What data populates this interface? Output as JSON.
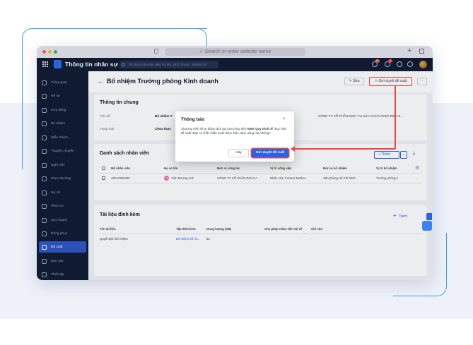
{
  "browser": {
    "url_placeholder": "Search or enter website name"
  },
  "app": {
    "title": "Thông tin nhân sự",
    "search_placeholder": "Tìm theo mã nhân viên, họ tên, SĐT, Email... (Nhấn F4)",
    "badges": [
      "99+",
      "9"
    ]
  },
  "sidebar": {
    "items": [
      {
        "label": "Tổng quan"
      },
      {
        "label": "Hồ sơ"
      },
      {
        "label": "Hợp đồng"
      },
      {
        "label": "Bổ nhiệm"
      },
      {
        "label": "Miễn nhiệm"
      },
      {
        "label": "Thuyên chuyển"
      },
      {
        "label": "Nghỉ việc"
      },
      {
        "label": "Khen thưởng"
      },
      {
        "label": "Sự cố"
      },
      {
        "label": "Phúc lợi"
      },
      {
        "label": "Quy hoạch"
      },
      {
        "label": "Đồng phục"
      },
      {
        "label": "Đề xuất"
      },
      {
        "label": "Báo cáo"
      },
      {
        "label": "Thiết lập"
      }
    ]
  },
  "page": {
    "title": "Bổ nhiệm Trưởng phòng Kinh doanh",
    "edit_label": "Sửa",
    "submit_label": "Gửi duyệt đề xuất",
    "more_label": "···"
  },
  "general": {
    "title": "Thông tin chung",
    "subject_label": "Tiêu đề",
    "subject_value": "Bổ nhiệm T",
    "status_label": "Trạng thái",
    "status_value": "Chưa thực",
    "company_value": "CÔNG TY CỔ PHẦN DỊCH VỤ SỬA CHỮA NHẸT ĐIỆN 8..."
  },
  "employees": {
    "title": "Danh sách nhân viên",
    "add_label": "Thêm",
    "columns": [
      "Mã nhân viên",
      "Họ và tên",
      "Đơn vị công tác",
      "Vị trí công việc",
      "Đơn vị bổ nhiệm",
      "Vị trí bổ nhiệm"
    ],
    "rows": [
      {
        "code": "ATM-0230482",
        "initials": "TA",
        "name": "Trần Dương Anh",
        "unit": "CÔNG TY CỔ PHẦN DỊCH V...",
        "position": "Nhân viên Content Market...",
        "new_unit": "Văn phòng Hồ Chí Minh",
        "new_position": "Trưởng phòng k"
      }
    ]
  },
  "attachments": {
    "title": "Tài liệu đính kèm",
    "add_label": "Thêm",
    "columns": [
      "Tên tài liệu",
      "Tệp đính kèm",
      "Dung lượng (KB)",
      "Cho phép nhân viên tải về",
      "Ghi chú"
    ],
    "rows": [
      {
        "name": "Quyết định bổ nhiệm",
        "file": "Bổ nhiệm bổ nh...",
        "size": "54",
        "download": "-",
        "note": "-"
      }
    ]
  },
  "dialog": {
    "title": "Thông báo",
    "close": "×",
    "body_pre": "Chương trình sẽ tự động khởi tạo lượt chạy trên ",
    "body_bold": "AMIS Quy trình",
    "body_post": " để thực hiện đề xuất. Bạn có chắc chắn muốn thực hiện chức năng này không?",
    "cancel_label": "Hủy",
    "confirm_label": "Gửi duyệt đề xuất"
  },
  "colors": {
    "accent": "#2563eb",
    "highlight": "#ef4444",
    "sidebar": "#111c33"
  }
}
